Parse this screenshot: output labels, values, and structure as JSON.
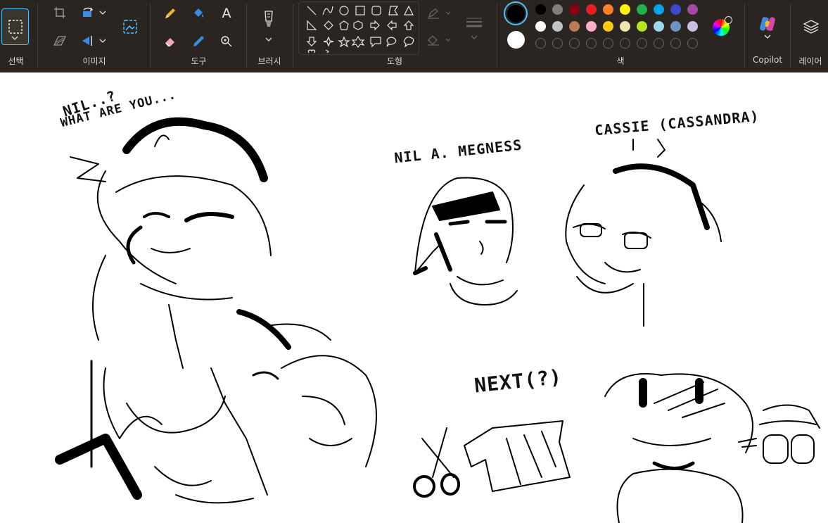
{
  "toolbar": {
    "groups": {
      "select": "선택",
      "image": "이미지",
      "tools": "도구",
      "brush": "브러시",
      "shapes": "도형",
      "colors": "색",
      "copilot": "Copilot",
      "layers": "레이어"
    },
    "text_tool_glyph": "A",
    "primary_color": "#000000",
    "secondary_color": "#ffffff",
    "palette_row1": [
      "#000000",
      "#7f7f7f",
      "#880015",
      "#ed1c24",
      "#ff7f27",
      "#fff200",
      "#22b14c",
      "#00a2e8",
      "#3f48cc",
      "#a349a4"
    ],
    "palette_row2": [
      "#ffffff",
      "#c3c3c3",
      "#b97a57",
      "#ffaec9",
      "#ffc90e",
      "#efe4b0",
      "#b5e61d",
      "#99d9ea",
      "#7092be",
      "#c8bfe7"
    ],
    "accent_color": "#4cc2ff"
  },
  "canvas": {
    "notes": {
      "nil_question": "NIL..?",
      "what_are_you": "WHAT ARE YOU...",
      "nila_name": "NIL A. MEGNESS",
      "cassie_name": "CASSIE (CASSANDRA)",
      "next": "NEXT(?)"
    }
  }
}
